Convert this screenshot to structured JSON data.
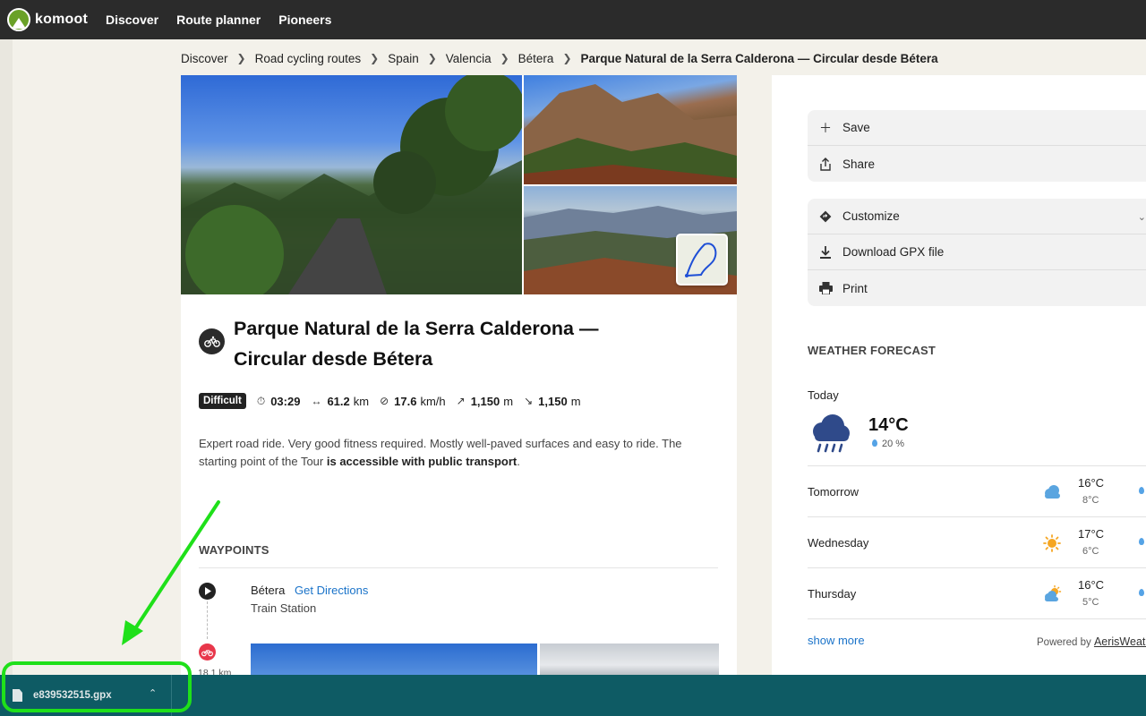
{
  "nav": {
    "logo": "komoot",
    "links": [
      "Discover",
      "Route planner",
      "Pioneers"
    ]
  },
  "breadcrumb": {
    "items": [
      "Discover",
      "Road cycling routes",
      "Spain",
      "Valencia",
      "Bétera"
    ],
    "current": "Parque Natural de la Serra Calderona — Circular desde Bétera"
  },
  "tour": {
    "title": "Parque Natural de la Serra Calderona — Circular desde Bétera",
    "difficulty": "Difficult",
    "duration": "03:29",
    "distance": "61.2",
    "distance_unit": "km",
    "speed": "17.6",
    "speed_unit": "km/h",
    "uphill": "1,150",
    "uphill_unit": "m",
    "downhill": "1,150",
    "downhill_unit": "m",
    "description": "Expert road ride. Very good fitness required. Mostly well-paved surfaces and easy to ride. The starting point of the Tour ",
    "description_bold": "is accessible with public transport",
    "description_end": "."
  },
  "waypoints": {
    "heading": "WAYPOINTS",
    "start_name": "Bétera",
    "directions_label": "Get Directions",
    "start_subtitle": "Train Station",
    "next_distance": "18.1 km"
  },
  "actions": {
    "save": "Save",
    "share": "Share",
    "customize": "Customize",
    "download_gpx": "Download GPX file",
    "print": "Print"
  },
  "weather": {
    "heading": "WEATHER FORECAST",
    "today_label": "Today",
    "today_temp": "14°C",
    "today_precip": "20 %",
    "days": [
      {
        "day": "Tomorrow",
        "high": "16°C",
        "low": "8°C",
        "icon": "cloud-icon"
      },
      {
        "day": "Wednesday",
        "high": "17°C",
        "low": "6°C",
        "icon": "sun-icon"
      },
      {
        "day": "Thursday",
        "high": "16°C",
        "low": "5°C",
        "icon": "partly-cloudy-icon"
      }
    ],
    "show_more": "show more",
    "powered_by": "Powered by",
    "provider": "AerisWeather"
  },
  "downloads": {
    "file_name": "e839532515.gpx"
  },
  "colors": {
    "nav_bg": "#2b2b2b",
    "page_bg": "#f3f1ea",
    "download_bar": "#0e5b64",
    "link": "#1a73c9",
    "highlight": "#1fe01a",
    "ride_red": "#e8374b"
  }
}
